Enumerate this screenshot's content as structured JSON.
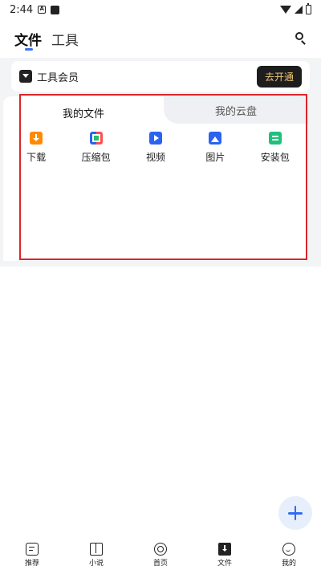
{
  "status_bar": {
    "time": "2:44",
    "notification_icon_a": "A",
    "icons": [
      "wifi-icon",
      "signal-icon",
      "battery-icon"
    ]
  },
  "header": {
    "tabs": [
      {
        "label": "文件",
        "active": true
      },
      {
        "label": "工具",
        "active": false
      }
    ],
    "search_icon": "search-icon"
  },
  "member_card": {
    "label": "工具会员",
    "button_label": "去开通"
  },
  "files_panel": {
    "tabs": [
      {
        "label": "我的文件",
        "active": true
      },
      {
        "label": "我的云盘",
        "active": false
      }
    ],
    "categories": [
      {
        "label": "下载",
        "icon": "download-icon",
        "color": "#ff8a00"
      },
      {
        "label": "压缩包",
        "icon": "zip-icon",
        "color": "#2b63f0"
      },
      {
        "label": "视频",
        "icon": "video-icon",
        "color": "#2b63f0"
      },
      {
        "label": "图片",
        "icon": "image-icon",
        "color": "#2b63f0"
      },
      {
        "label": "安装包",
        "icon": "apk-icon",
        "color": "#1fc07a"
      }
    ]
  },
  "fab": {
    "icon": "plus-icon",
    "color": "#2f6cf6"
  },
  "bottom_nav": [
    {
      "label": "推荐",
      "icon": "recommend-icon"
    },
    {
      "label": "小说",
      "icon": "book-icon"
    },
    {
      "label": "首页",
      "icon": "home-icon"
    },
    {
      "label": "文件",
      "icon": "file-icon"
    },
    {
      "label": "我的",
      "icon": "profile-icon"
    }
  ]
}
